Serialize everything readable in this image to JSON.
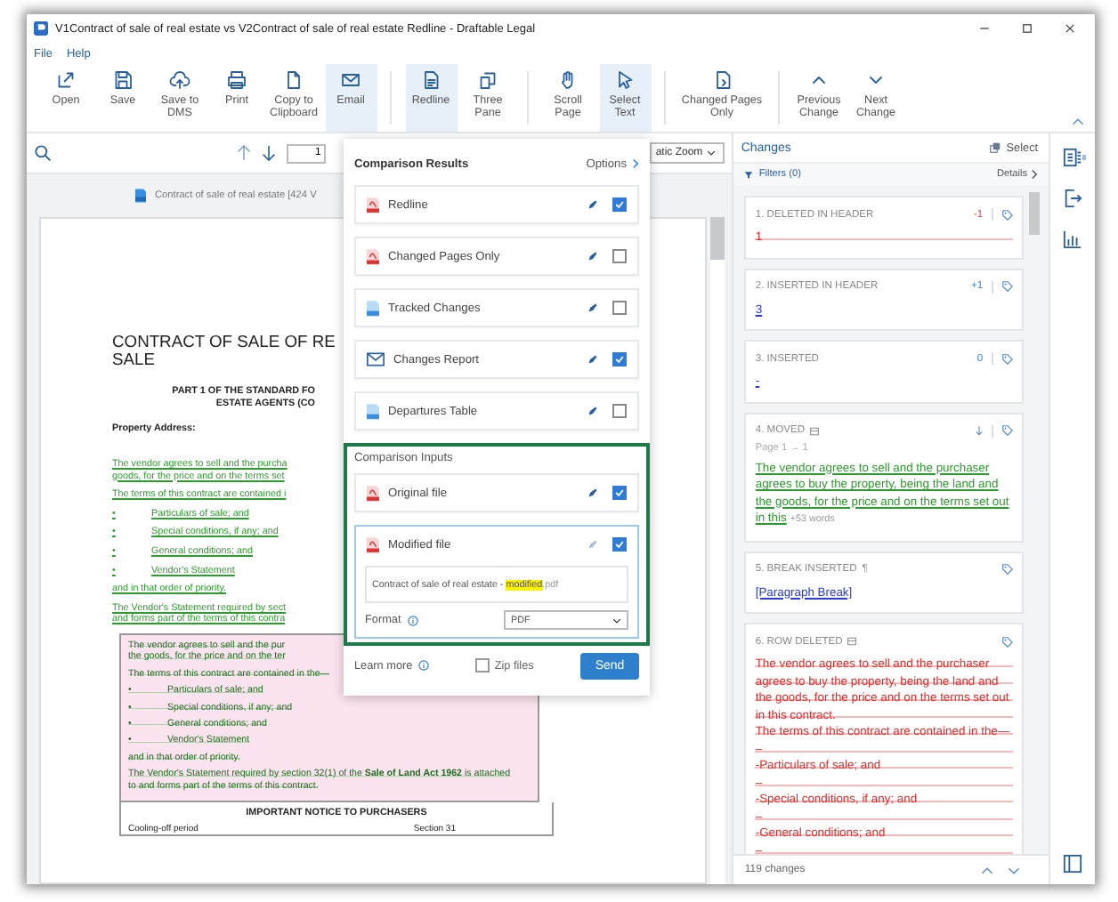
{
  "window": {
    "title": "V1Contract of sale of real estate vs V2Contract of sale of real estate Redline - Draftable Legal"
  },
  "menu": [
    "File",
    "Help"
  ],
  "toolbar_groups": [
    [
      {
        "label": "Open",
        "selected": false
      },
      {
        "label": "Save",
        "selected": false
      },
      {
        "label": "Save to DMS",
        "selected": false
      },
      {
        "label": "Print",
        "selected": false
      },
      {
        "label": "Copy to Clipboard",
        "selected": false
      },
      {
        "label": "Email",
        "selected": true
      }
    ],
    [
      {
        "label": "Redline",
        "selected": true
      },
      {
        "label": "Three Pane",
        "selected": false
      }
    ],
    [
      {
        "label": "Scroll Page",
        "selected": false
      },
      {
        "label": "Select Text",
        "selected": true
      }
    ],
    [
      {
        "label": "Changed Pages Only",
        "selected": false
      }
    ],
    [
      {
        "label": "Previous Change",
        "selected": false
      },
      {
        "label": "Next Change",
        "selected": false
      }
    ]
  ],
  "document": {
    "page_input": "1",
    "zoom": "atic Zoom",
    "file_label": "Contract of sale of real estate [424 V",
    "heading": [
      "CONTRACT OF SALE OF RE",
      "SALE"
    ],
    "subheading": [
      "PART 1 OF THE STANDARD FO",
      "ESTATE AGENTS (CO"
    ],
    "address_label": "Property Address:",
    "inserted": [
      {
        "kind": "text",
        "lines": [
          "The vendor agrees to sell and the purcha",
          "goods, for the price and on the terms set"
        ]
      },
      {
        "kind": "text",
        "lines": [
          "The terms of this contract are contained i"
        ]
      },
      {
        "kind": "bullet",
        "bullet": "•",
        "lines": [
          "Particulars of sale; and"
        ]
      },
      {
        "kind": "bullet",
        "bullet": "•",
        "lines": [
          "Special conditions, if any; and"
        ]
      },
      {
        "kind": "bullet",
        "bullet": "•",
        "lines": [
          "General conditions; and"
        ]
      },
      {
        "kind": "bullet",
        "bullet": "•",
        "lines": [
          "Vendor's Statement"
        ]
      },
      {
        "kind": "text",
        "lines": [
          "and in that order of priority."
        ]
      },
      {
        "kind": "text",
        "lines": [
          "The Vendor's Statement required by sect",
          "and forms part of the terms of this contra"
        ]
      }
    ],
    "deleted": [
      {
        "kind": "text",
        "lines": [
          "The vendor agrees to sell and the pur",
          "the goods, for the price and on the ter"
        ]
      },
      {
        "kind": "text",
        "lines": [
          "The terms of this contract are contained in the—"
        ]
      },
      {
        "kind": "bullet",
        "bullet": "•",
        "lines": [
          "Particulars of sale; and"
        ]
      },
      {
        "kind": "bullet",
        "bullet": "•",
        "lines": [
          "Special conditions, if any; and"
        ]
      },
      {
        "kind": "bullet",
        "bullet": "•",
        "lines": [
          "General conditions; and"
        ]
      },
      {
        "kind": "bullet",
        "bullet": "•",
        "lines": [
          "Vendor's Statement"
        ]
      },
      {
        "kind": "text",
        "lines": [
          "and in that order of priority."
        ]
      },
      {
        "kind": "text",
        "lines": [
          "The Vendor's Statement required by section 32(1) of the **Sale of Land Act 1962** is attached",
          "to and forms part of the terms of this contract."
        ]
      }
    ],
    "notice": "IMPORTANT NOTICE TO PURCHASERS",
    "notice_row": [
      "Cooling-off period",
      "Section 31"
    ]
  },
  "export_panel": {
    "results_title": "Comparison Results",
    "options": "Options",
    "results": [
      {
        "label": "Redline",
        "kind": "pdf",
        "checked": true
      },
      {
        "label": "Changed Pages Only",
        "kind": "pdf",
        "checked": false
      },
      {
        "label": "Tracked Changes",
        "kind": "word",
        "checked": false
      },
      {
        "label": "Changes Report",
        "kind": "mail",
        "checked": true
      },
      {
        "label": "Departures Table",
        "kind": "word",
        "checked": false
      }
    ],
    "inputs_title": "Comparison Inputs",
    "inputs": [
      {
        "label": "Original file",
        "checked": true,
        "expanded": false
      },
      {
        "label": "Modified file",
        "checked": true,
        "expanded": true,
        "file_name": {
          "before": "Contract of sale of real estate - ",
          "highlighted": "modified",
          "after": ".pdf"
        },
        "format_label": "Format",
        "format": "PDF"
      }
    ],
    "learn_more": "Learn more",
    "zip": {
      "label": "Zip files",
      "checked": false
    },
    "send": "Send"
  },
  "changes_panel": {
    "title": "Changes",
    "select": "Select",
    "filters": "Filters (0)",
    "details": "Details",
    "items": [
      {
        "title": "1. DELETED IN HEADER",
        "kind": "deleted",
        "count": "-1",
        "lines": [
          "1"
        ]
      },
      {
        "title": "2. INSERTED IN HEADER",
        "kind": "inserted",
        "count": "+1",
        "lines": [
          "3"
        ]
      },
      {
        "title": "3. INSERTED",
        "kind": "inserted",
        "count": "0",
        "lines": [
          "-"
        ]
      },
      {
        "title": "4. MOVED",
        "kind": "moved",
        "page": "Page 1 → 1",
        "lines": [
          "The vendor agrees to sell and the purchaser agrees to buy the property, being the land and the goods, for the price and on the terms set out in this"
        ],
        "more": "+53 words"
      },
      {
        "title": "5. BREAK INSERTED",
        "kind": "break",
        "symbol": "¶",
        "lines": [
          "[Paragraph Break]"
        ]
      },
      {
        "title": "6. ROW DELETED",
        "kind": "row_deleted",
        "lines": [
          "The vendor agrees to sell and the purchaser agrees to buy the property, being the land and the goods, for the price and on the terms set out in this contract.",
          "The terms of this contract are contained in the—",
          "–",
          "-Particulars of sale; and",
          "–",
          "-Special conditions, if any; and",
          "–",
          "-General conditions; and",
          "–"
        ]
      }
    ],
    "footer": "119 changes"
  }
}
